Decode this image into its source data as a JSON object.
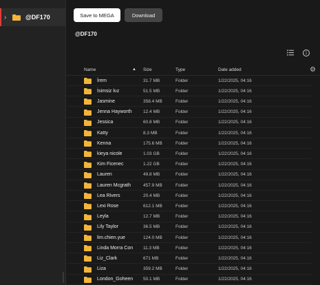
{
  "sidebar": {
    "folder_name": "@DF170"
  },
  "toolbar": {
    "save_label": "Save to MEGA",
    "download_label": "Download"
  },
  "breadcrumb": "@DF170",
  "header": {
    "name": "Name",
    "size": "Size",
    "type": "Type",
    "date": "Date added"
  },
  "colors": {
    "folder": "#f2b53a",
    "accent": "#e53935"
  },
  "rows": [
    {
      "name": "Írem",
      "size": "31.7 MB",
      "type": "Folder",
      "date": "1/22/2025, 04:16"
    },
    {
      "name": "İsimsiz kız",
      "size": "51.5 MB",
      "type": "Folder",
      "date": "1/22/2025, 04:16"
    },
    {
      "name": "Jasmine",
      "size": "358.4 MB",
      "type": "Folder",
      "date": "1/22/2025, 04:16"
    },
    {
      "name": "Jenna Hayworth",
      "size": "12.4 MB",
      "type": "Folder",
      "date": "1/22/2025, 04:16"
    },
    {
      "name": "Jessica",
      "size": "60.8 MB",
      "type": "Folder",
      "date": "1/22/2025, 04:16"
    },
    {
      "name": "Katty",
      "size": "8.3 MB",
      "type": "Folder",
      "date": "1/22/2025, 04:16"
    },
    {
      "name": "Kenna",
      "size": "175.6 MB",
      "type": "Folder",
      "date": "1/22/2025, 04:16"
    },
    {
      "name": "kieya nicole",
      "size": "1.03 GB",
      "type": "Folder",
      "date": "1/22/2025, 04:16"
    },
    {
      "name": "Kim Ficenec",
      "size": "1.22 GB",
      "type": "Folder",
      "date": "1/22/2025, 04:16"
    },
    {
      "name": "Lauren",
      "size": "49.8 MB",
      "type": "Folder",
      "date": "1/22/2025, 04:16"
    },
    {
      "name": "Lauren Mcgrath",
      "size": "457.9 MB",
      "type": "Folder",
      "date": "1/22/2025, 04:16"
    },
    {
      "name": "Lea Rivers",
      "size": "20.4 MB",
      "type": "Folder",
      "date": "1/22/2025, 04:16"
    },
    {
      "name": "Lexi Rose",
      "size": "612.1 MB",
      "type": "Folder",
      "date": "1/22/2025, 04:16"
    },
    {
      "name": "Leyla",
      "size": "12.7 MB",
      "type": "Folder",
      "date": "1/22/2025, 04:16"
    },
    {
      "name": "Lily Taylor",
      "size": "36.5 MB",
      "type": "Folder",
      "date": "1/22/2025, 04:16"
    },
    {
      "name": "lim.chien.yue",
      "size": "124.0 MB",
      "type": "Folder",
      "date": "1/22/2025, 04:16"
    },
    {
      "name": "Linda Morra Con",
      "size": "11.3 MB",
      "type": "Folder",
      "date": "1/22/2025, 04:16"
    },
    {
      "name": "Liz_Clark",
      "size": "671 MB",
      "type": "Folder",
      "date": "1/22/2025, 04:16"
    },
    {
      "name": "Liza",
      "size": "359.2 MB",
      "type": "Folder",
      "date": "1/22/2025, 04:16"
    },
    {
      "name": "London_Goheen",
      "size": "50.1 MB",
      "type": "Folder",
      "date": "1/22/2025, 04:16"
    }
  ]
}
